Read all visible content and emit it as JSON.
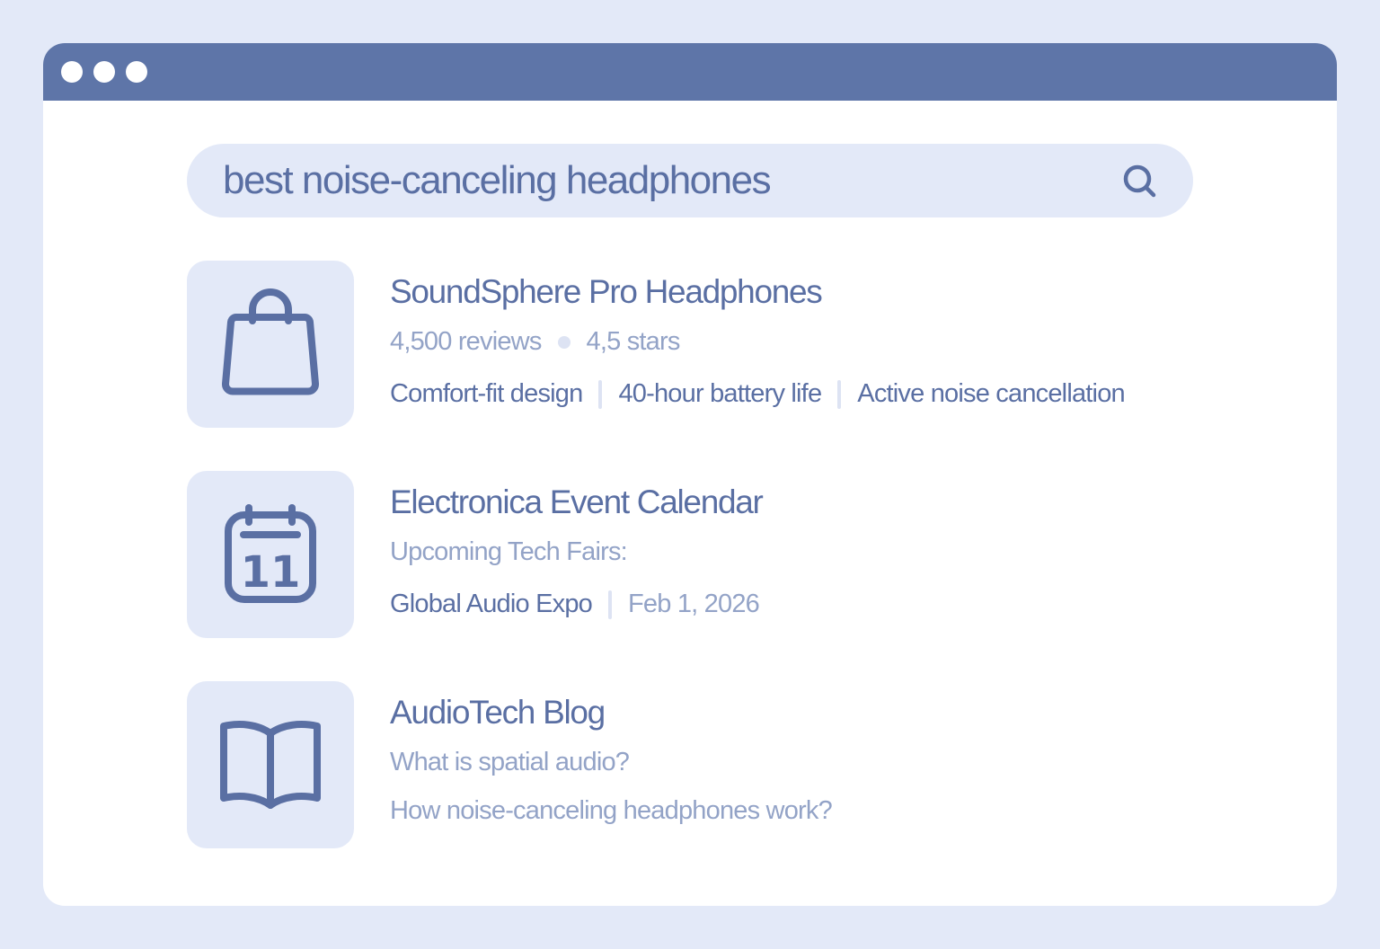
{
  "window": {
    "controls": [
      "window-dot",
      "window-dot",
      "window-dot"
    ]
  },
  "search": {
    "query": "best noise-canceling headphones",
    "icon": "search-icon"
  },
  "results": [
    {
      "icon": "shopping-bag-icon",
      "title": "SoundSphere Pro Headphones",
      "reviews": "4,500 reviews",
      "rating": "4,5 stars",
      "features": [
        "Comfort-fit design",
        "40-hour battery life",
        "Active noise cancellation"
      ]
    },
    {
      "icon": "calendar-icon",
      "calendar_day": "11",
      "title": "Electronica Event Calendar",
      "subtitle": "Upcoming Tech Fairs:",
      "event_name": "Global Audio Expo",
      "event_date": "Feb 1, 2026"
    },
    {
      "icon": "open-book-icon",
      "title": "AudioTech Blog",
      "articles": [
        "What is spatial audio?",
        "How noise-canceling headphones work?"
      ]
    }
  ],
  "colors": {
    "page_background": "#e3e9f8",
    "titlebar": "#5e75a8",
    "accent_text": "#5a6fa3",
    "muted_text": "#93a3c7",
    "separator": "#dde3f3",
    "tile_background": "#e3e9f8"
  }
}
